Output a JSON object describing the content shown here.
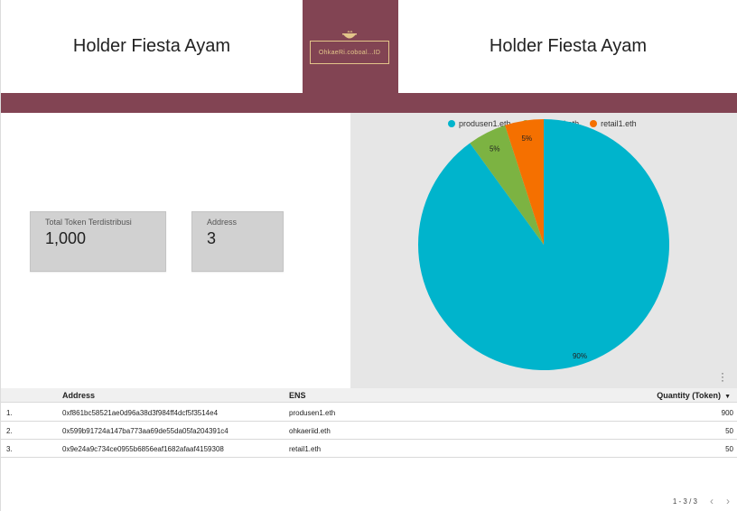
{
  "header": {
    "title_left": "Holder Fiesta Ayam",
    "title_right": "Holder Fiesta Ayam",
    "logo_text": "OhkaeRi.coboal...ID",
    "brand_color": "#824453",
    "logo_color": "#e3c58a"
  },
  "scorecards": [
    {
      "label": "Total Token Terdistribusi",
      "value": "1,000"
    },
    {
      "label": "Address",
      "value": "3"
    }
  ],
  "chart_data": {
    "type": "pie",
    "categories": [
      "produsen1.eth",
      "ohkaeriid.eth",
      "retail1.eth"
    ],
    "values": [
      900,
      50,
      50
    ],
    "labels": [
      "90%",
      "5%",
      "5%"
    ],
    "colors": [
      "#00b4cc",
      "#7cb342",
      "#f57000"
    ],
    "legend": "top"
  },
  "table": {
    "headers": {
      "address": "Address",
      "ens": "ENS",
      "quantity": "Quantity (Token)"
    },
    "rows": [
      {
        "num": "1.",
        "address": "0xf861bc58521ae0d96a38d3f984ff4dcf5f3514e4",
        "ens": "produsen1.eth",
        "quantity": "900"
      },
      {
        "num": "2.",
        "address": "0x599b91724a147ba773aa69de55da05fa204391c4",
        "ens": "ohkaeriid.eth",
        "quantity": "50"
      },
      {
        "num": "3.",
        "address": "0x9e24a9c734ce0955b6856eaf1682afaaf4159308",
        "ens": "retail1.eth",
        "quantity": "50"
      }
    ]
  },
  "pager": {
    "range": "1 - 3 / 3",
    "prev_icon": "chevron-left-icon",
    "next_icon": "chevron-right-icon"
  }
}
